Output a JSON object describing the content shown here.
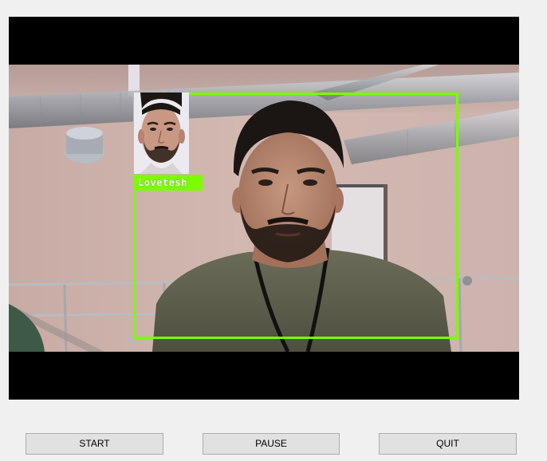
{
  "video": {
    "recognized_name": "Lovetesh",
    "box_color": "#7cfc00",
    "letterbox_color": "#000000"
  },
  "controls": {
    "start_label": "START",
    "pause_label": "PAUSE",
    "quit_label": "QUIT"
  }
}
